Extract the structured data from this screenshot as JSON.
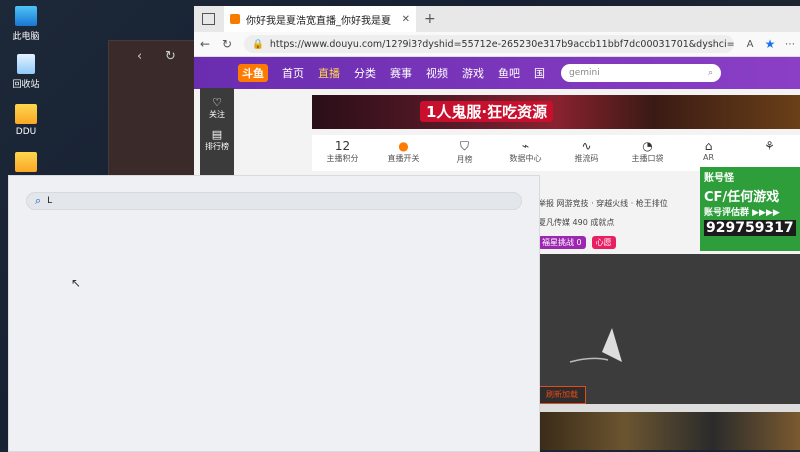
{
  "desktop": {
    "icons": [
      {
        "label": "此电脑",
        "icon": "computer-icon"
      },
      {
        "label": "回收站",
        "icon": "recycle-bin-icon"
      },
      {
        "label": "DDU",
        "icon": "folder-icon"
      }
    ]
  },
  "browser": {
    "tab_title": "你好我是夏浩宽直播_你好我是夏",
    "url": "https://www.douyu.com/12?9i3?dyshid=55712e-265230e317b9accb11bbf7dc00031701&dyshci=33"
  },
  "douyu": {
    "logo": "斗鱼",
    "nav": [
      "首页",
      "直播",
      "分类",
      "赛事",
      "视频",
      "游戏",
      "鱼吧",
      "国"
    ],
    "search_placeholder": "gemini",
    "sidebar": [
      {
        "label": "关注",
        "icon": "heart-icon"
      },
      {
        "label": "排行榜",
        "icon": "ranking-icon"
      }
    ],
    "banner_text": "1人鬼服·狂吃资源",
    "toolbar": [
      {
        "num": "12",
        "label": "主播积分"
      },
      {
        "num": "开",
        "label": "直播开关"
      },
      {
        "num": "",
        "label": "月榜"
      },
      {
        "num": "",
        "label": "数据中心"
      },
      {
        "num": "",
        "label": "推流码"
      },
      {
        "num": "",
        "label": "主播口袋"
      },
      {
        "num": "",
        "label": "AR"
      },
      {
        "num": "",
        "label": ""
      }
    ],
    "room_breadcrumb": "举报  网游竞技 · 穿越火线 · 枪王排位",
    "room_meta": "夏凡传媒   490 成就点",
    "badges": [
      "福星挑战 0",
      "心愿"
    ],
    "reload_label": "刷新加载",
    "ad": {
      "line1": "账号怪",
      "line2": "CF/任何游戏",
      "line3": "账号评估群 ▶▶▶▶",
      "qq": "929759317"
    }
  },
  "overlay": {
    "search_value": "L"
  },
  "colors": {
    "douyu_purple": "#7a34bd",
    "accent_orange": "#ff7a00"
  }
}
